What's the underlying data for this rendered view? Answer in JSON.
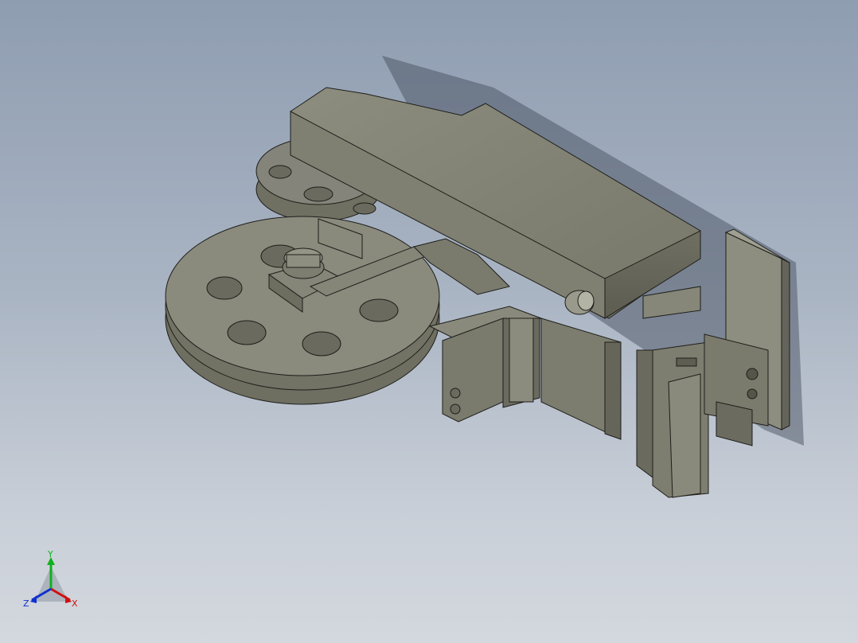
{
  "viewport": {
    "name": "cad-3d-viewport"
  },
  "triad": {
    "x_label": "X",
    "y_label": "Y",
    "z_label": "Z",
    "x_color": "#d01010",
    "y_color": "#10b020",
    "z_color": "#1030d0"
  },
  "model": {
    "body_color": "#7f7f70",
    "edge_color": "#1e1e1a"
  }
}
